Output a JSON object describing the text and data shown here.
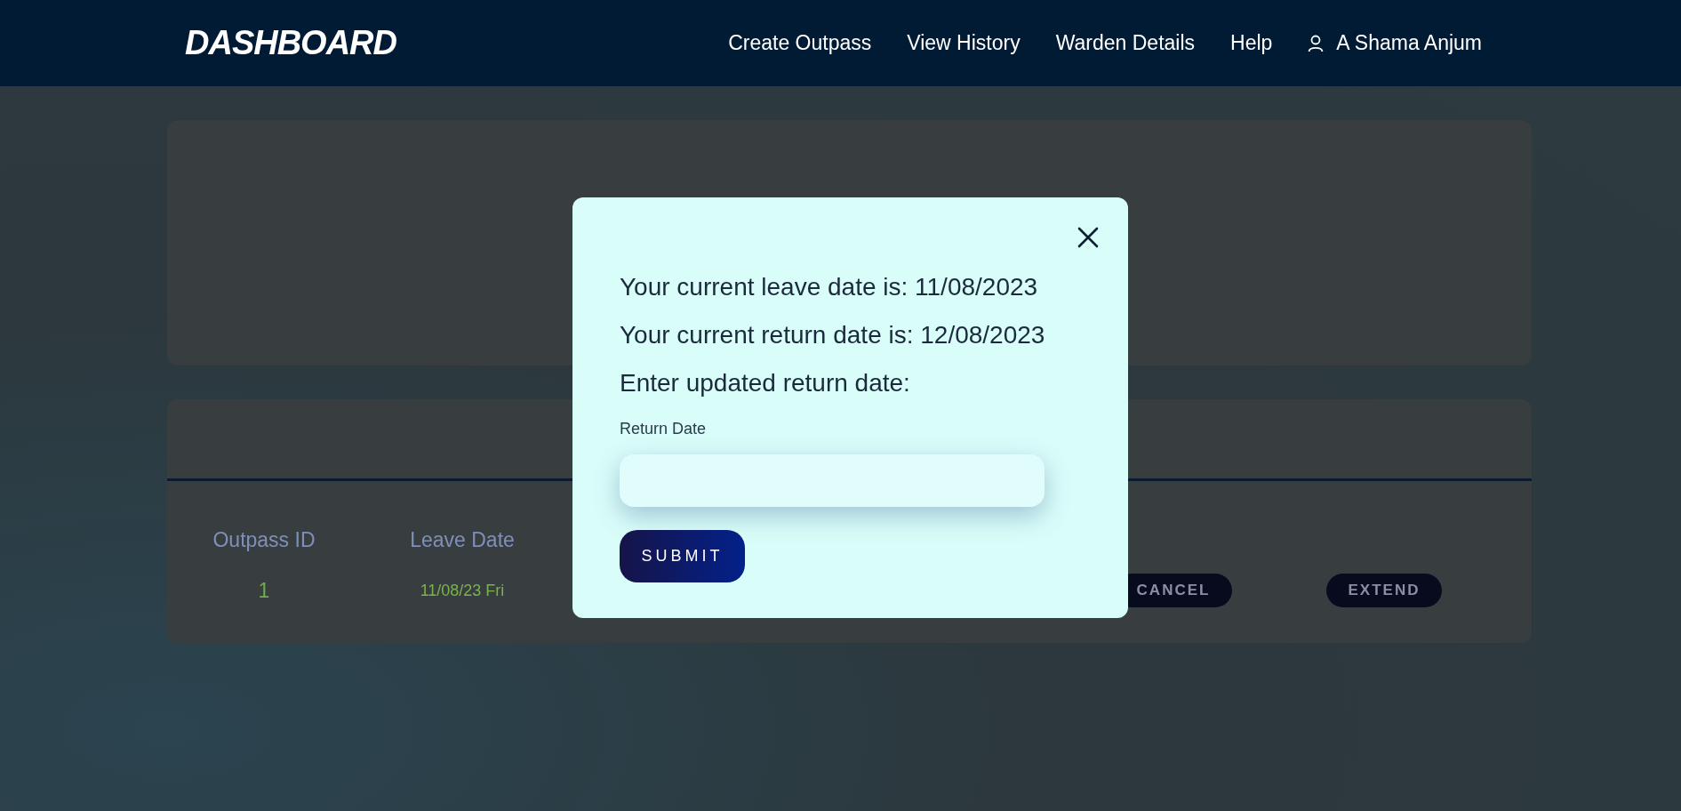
{
  "header": {
    "logo": "DASHBOARD",
    "nav": [
      "Create Outpass",
      "View History",
      "Warden Details",
      "Help"
    ],
    "user": "A Shama Anjum"
  },
  "table": {
    "columns": [
      "Outpass ID",
      "Leave Date"
    ],
    "rows": [
      {
        "cells": [
          "1",
          "11/08/23 Fri"
        ],
        "actions": [
          "CANCEL",
          "EXTEND"
        ]
      }
    ]
  },
  "modal": {
    "lines": [
      "Your current leave date is: 11/08/2023",
      "Your current return date is: 12/08/2023",
      "Enter updated return date:"
    ],
    "field": {
      "label": "Return Date"
    },
    "submit": "SUBMIT"
  }
}
